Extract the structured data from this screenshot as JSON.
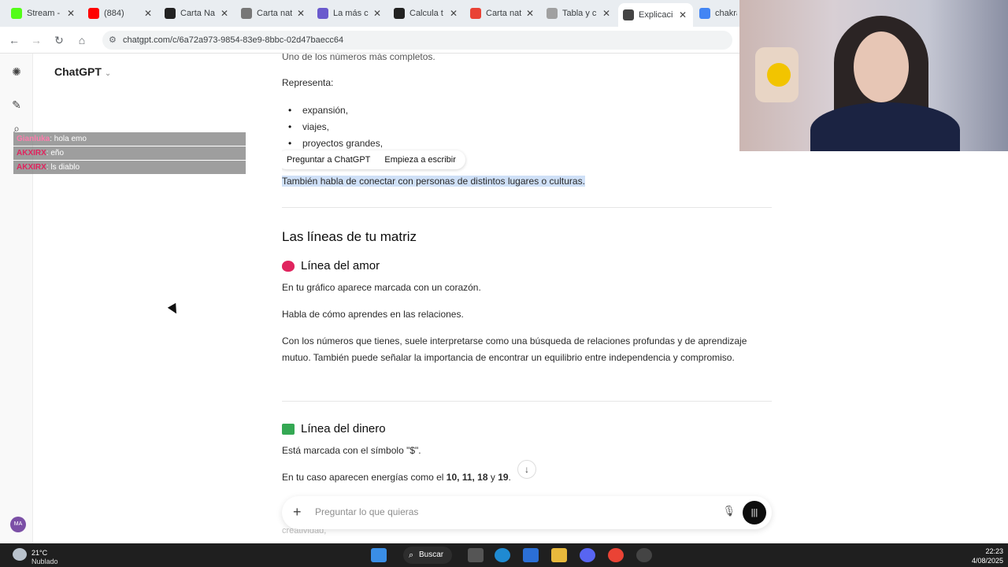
{
  "browser": {
    "tabs": [
      {
        "title": "Stream -",
        "favicon": "kick-icon",
        "color": "#53fc18"
      },
      {
        "title": "(884)",
        "favicon": "youtube-icon",
        "color": "#ff0000"
      },
      {
        "title": "Carta Na",
        "favicon": "site-icon",
        "color": "#222222"
      },
      {
        "title": "Carta nat",
        "favicon": "globe-icon",
        "color": "#777777"
      },
      {
        "title": "La más co",
        "favicon": "puzzle-icon",
        "color": "#6a5acd"
      },
      {
        "title": "Calcula t",
        "favicon": "site-icon",
        "color": "#222222"
      },
      {
        "title": "Carta nat",
        "favicon": "sheets-icon",
        "color": "#e94235"
      },
      {
        "title": "Tabla y c",
        "favicon": "site-icon",
        "color": "#a0a0a0"
      },
      {
        "title": "Explicaci",
        "favicon": "openai-icon",
        "color": "#444444",
        "active": true
      },
      {
        "title": "chakras",
        "favicon": "google-icon",
        "color": "#4285f4"
      }
    ],
    "url": "chatgpt.com/c/6a72a973-9854-83e9-8bbc-02d47baecc64"
  },
  "sidebar": {
    "brand": "ChatGPT"
  },
  "chat_overlay": [
    {
      "user": "Gianluka",
      "message": ": hola emo"
    },
    {
      "user": "AKXIRX",
      "message": ": eño"
    },
    {
      "user": "AKXIRX",
      "message": ": ls diablo"
    }
  ],
  "content": {
    "top_cut": "Uno de los números más completos.",
    "represents_label": "Representa:",
    "bullets": [
      "expansión,",
      "viajes,",
      "proyectos grandes,"
    ],
    "popup": {
      "ask": "Preguntar a ChatGPT",
      "write": "Empieza a escribir"
    },
    "highlighted": "También habla de conectar con personas de distintos lugares o culturas.",
    "section_title": "Las líneas de tu matriz",
    "love": {
      "title": "Línea del amor",
      "p1": "En tu gráfico aparece marcada con un corazón.",
      "p2": "Habla de cómo aprendes en las relaciones.",
      "p3": "Con los números que tienes, suele interpretarse como una búsqueda de relaciones profundas y de aprendizaje mutuo. También puede señalar la importancia de encontrar un equilibrio entre independencia y compromiso."
    },
    "money": {
      "title": "Línea del dinero",
      "p1": "Está marcada con el símbolo \"$\".",
      "p2_prefix": "En tu caso aparecen energías como el ",
      "p2_numbers": "10, 11, 18",
      "p2_mid": " y ",
      "p2_last": "19",
      "p2_end": "."
    },
    "fade_bullet": "creatividad,"
  },
  "composer": {
    "placeholder": "Preguntar lo que quieras"
  },
  "taskbar": {
    "temperature": "21°C",
    "condition": "Nublado",
    "search": "Buscar",
    "time": "22:23",
    "date": "4/08/2025"
  }
}
